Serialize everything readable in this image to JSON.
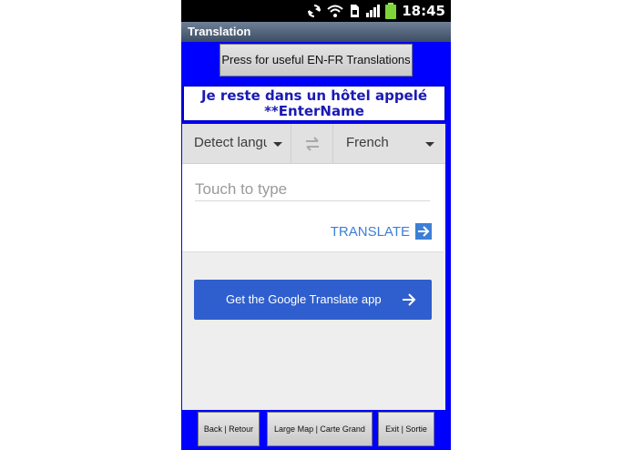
{
  "status_bar": {
    "time": "18:45",
    "icons": [
      "sync-icon",
      "wifi-icon",
      "sim-icon",
      "signal-icon",
      "battery-icon"
    ]
  },
  "app": {
    "title": "Translation"
  },
  "top_button": {
    "label": "Press for useful EN-FR Translations"
  },
  "phrase": {
    "line1": "Je reste dans un hôtel appelé",
    "line2": "**EnterName"
  },
  "translator": {
    "source_language": "Detect langu",
    "target_language": "French",
    "input_placeholder": "Touch to type",
    "translate_label": "TRANSLATE",
    "get_app_label": "Get the Google Translate app"
  },
  "bottom_buttons": {
    "back": "Back | Retour",
    "map": "Large Map | Carte Grand",
    "exit": "Exit | Sortie"
  },
  "colors": {
    "background_blue": "#0000ff",
    "phrase_text": "#1a1ab4",
    "link_blue": "#3c7fd6",
    "app_button": "#2f5fce"
  }
}
